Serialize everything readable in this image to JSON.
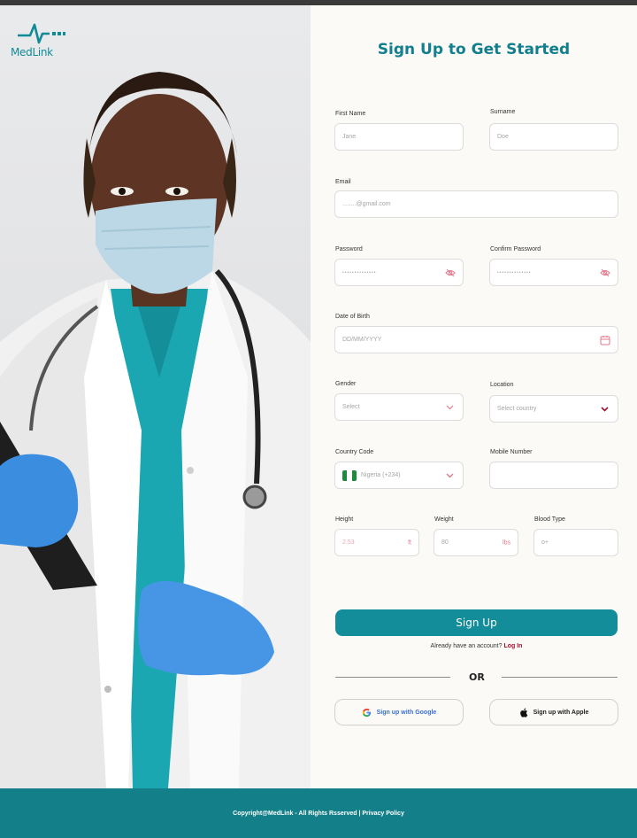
{
  "brand": {
    "name": "MedLink"
  },
  "form": {
    "title": "Sign Up to Get Started",
    "first_name": {
      "label": "First Name",
      "placeholder": "Jane"
    },
    "surname": {
      "label": "Surname",
      "placeholder": "Doe"
    },
    "email": {
      "label": "Email",
      "placeholder": "........@gmail.com"
    },
    "password": {
      "label": "Password",
      "placeholder": "••••••••••••••"
    },
    "confirm_password": {
      "label": "Confirm Password",
      "placeholder": "••••••••••••••"
    },
    "dob": {
      "label": "Date of Birth",
      "placeholder": "DD/MM/YYYY"
    },
    "gender": {
      "label": "Gender",
      "selected": "Select"
    },
    "location": {
      "label": "Location",
      "selected": "Select country"
    },
    "country_code": {
      "label": "Country Code",
      "selected": "Nigeria (+234)"
    },
    "mobile": {
      "label": "Mobile Number",
      "placeholder": ""
    },
    "height": {
      "label": "Height",
      "placeholder": "2.53",
      "unit": "ft"
    },
    "weight": {
      "label": "Weight",
      "placeholder": "80",
      "unit": "lbs"
    },
    "blood_type": {
      "label": "Blood Type",
      "placeholder": "o+"
    },
    "signup_label": "Sign Up",
    "login_prompt": "Already have an account?",
    "login_link": "Log In",
    "or_label": "OR",
    "google_label": "Sign up with Google",
    "apple_label": "Sign up with Apple"
  },
  "footer": {
    "text": "Copyright@MedLink - All Rights Rsserved | Privacy Policy"
  },
  "colors": {
    "teal": "#138d9a",
    "pink": "#e07b8f",
    "login": "#a6122f",
    "footer": "#127f89"
  },
  "icons": [
    "logo-icon",
    "eye-off-icon",
    "calendar-icon",
    "chevron-down-icon",
    "nigeria-flag-icon",
    "google-icon",
    "apple-icon"
  ]
}
